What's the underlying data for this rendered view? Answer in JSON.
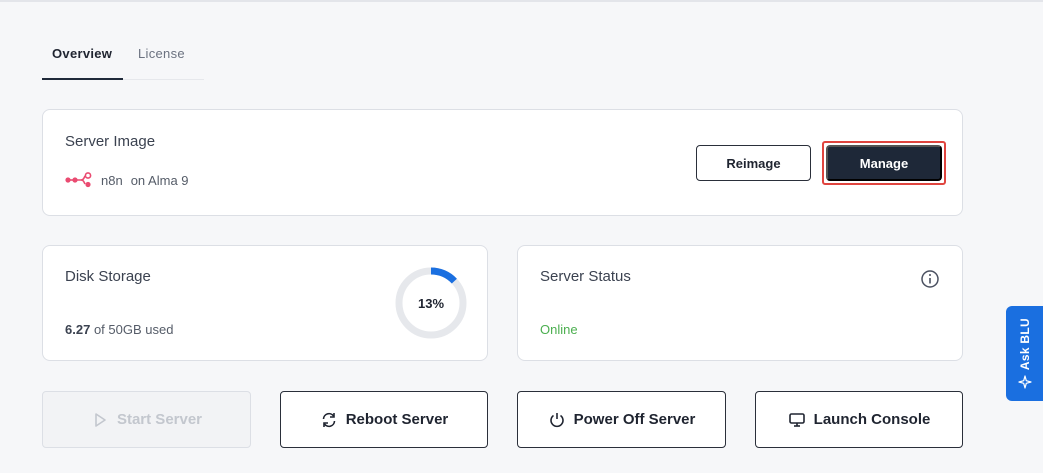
{
  "tabs": [
    {
      "label": "Overview",
      "active": true
    },
    {
      "label": "License",
      "active": false
    }
  ],
  "server_image": {
    "title": "Server Image",
    "app_name": "n8n",
    "os_text": "on Alma 9",
    "logo_icon": "n8n-logo-icon",
    "reimage_label": "Reimage",
    "manage_label": "Manage"
  },
  "disk_storage": {
    "title": "Disk Storage",
    "used": "6.27",
    "usage_suffix": "of 50GB used",
    "percent_label": "13%",
    "percent_value": 13
  },
  "server_status": {
    "title": "Server Status",
    "status": "Online",
    "info_icon": "info-icon"
  },
  "actions": {
    "start": {
      "label": "Start Server",
      "disabled": true,
      "icon": "play-icon"
    },
    "reboot": {
      "label": "Reboot Server",
      "disabled": false,
      "icon": "refresh-icon"
    },
    "power_off": {
      "label": "Power Off Server",
      "disabled": false,
      "icon": "power-icon"
    },
    "console": {
      "label": "Launch Console",
      "disabled": false,
      "icon": "monitor-icon"
    }
  },
  "ask_blu": {
    "label": "Ask BLU",
    "icon": "sparkle-icon"
  },
  "colors": {
    "primary_dark": "#1e2838",
    "accent_blue": "#1a6fe0",
    "status_online": "#4caf50",
    "highlight_red": "#e0453f",
    "n8n_pink": "#ea4b71"
  }
}
